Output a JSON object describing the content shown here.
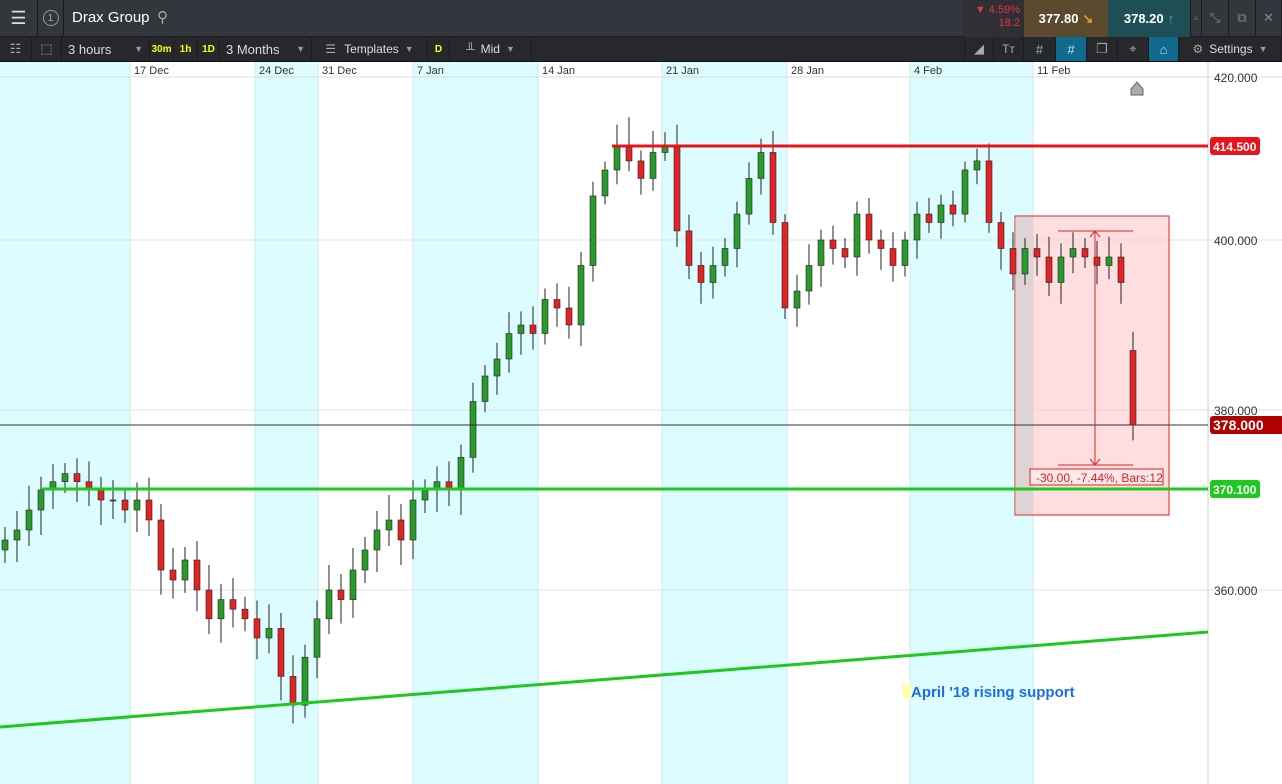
{
  "header": {
    "instrument": "Drax Group",
    "change_pct": "▼ 4.59%",
    "change_abs": "18.2",
    "sell_price": "377.80",
    "buy_price": "378.20",
    "window_number": "1"
  },
  "toolbar": {
    "interval": "3 hours",
    "quick_intervals": [
      "30m",
      "1h",
      "1D"
    ],
    "range": "3 Months",
    "templates": "Templates",
    "d_label": "D",
    "price_type": "Mid",
    "settings": "Settings"
  },
  "colors": {
    "sell": "#6b5430",
    "buy": "#1f5d62",
    "down": "#e02424",
    "up": "#2a9a2a"
  },
  "chart_data": {
    "type": "candlestick",
    "instrument": "Drax Group",
    "interval": "3 hours",
    "x_tick_labels": [
      "17 Dec",
      "24 Dec",
      "31 Dec",
      "7 Jan",
      "14 Jan",
      "21 Jan",
      "28 Jan",
      "4 Feb",
      "11 Feb"
    ],
    "y_tick_labels": [
      "420.000",
      "400.000",
      "380.000",
      "360.000"
    ],
    "closes": [
      365,
      366,
      368,
      370,
      371,
      372,
      371,
      370,
      369,
      369,
      368,
      369,
      367,
      362,
      361,
      363,
      360,
      357,
      359,
      358,
      357,
      355,
      356,
      351,
      348,
      353,
      357,
      360,
      359,
      362,
      364,
      366,
      367,
      365,
      369,
      370,
      371,
      370,
      374,
      381,
      384,
      386,
      389,
      390,
      389,
      393,
      392,
      390,
      397,
      406.8,
      410.8,
      414.3,
      412.2,
      409.5,
      413.5,
      414.3,
      401.4,
      397,
      395,
      397,
      399,
      404,
      409.5,
      413.5,
      402.7,
      392,
      394,
      397,
      400,
      399,
      398,
      404,
      400,
      399,
      397,
      400,
      404,
      402.7,
      405.4,
      404,
      410.8,
      412.2,
      402.7,
      399,
      396,
      399,
      398,
      395,
      398,
      399,
      398,
      397,
      398,
      395,
      378
    ],
    "last_open": 387,
    "levels": [
      {
        "name": "resistance",
        "value": "414.500",
        "color": "#e8141c"
      },
      {
        "name": "current",
        "value": "378.000",
        "color": "#b00000"
      },
      {
        "name": "support",
        "value": "370.100",
        "color": "#1ec81e"
      }
    ],
    "measure": {
      "label": "-30.00, -7.44%, Bars:12"
    },
    "annotation": "April '18 rising support"
  }
}
